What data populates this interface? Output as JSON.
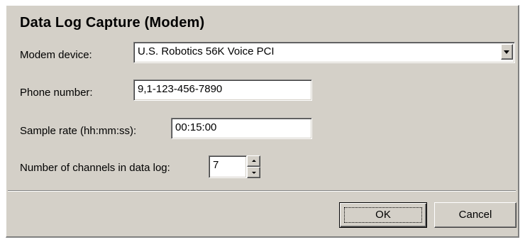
{
  "dialog": {
    "title": "Data Log Capture (Modem)"
  },
  "fields": {
    "modem_device": {
      "label": "Modem device:",
      "value": "U.S. Robotics 56K Voice PCI"
    },
    "phone_number": {
      "label": "Phone number:",
      "value": "9,1-123-456-7890"
    },
    "sample_rate": {
      "label": "Sample rate (hh:mm:ss):",
      "value": "00:15:00"
    },
    "channels": {
      "label": "Number of channels in data log:",
      "value": "7"
    }
  },
  "buttons": {
    "ok_label": "OK",
    "cancel_label": "Cancel"
  },
  "icons": {
    "dropdown": "chevron-down-icon",
    "spin_up": "spin-up-arrow-icon",
    "spin_down": "spin-down-arrow-icon"
  },
  "colors": {
    "dialog_background": "#d4d0c8",
    "field_background": "#ffffff",
    "text": "#000000"
  }
}
